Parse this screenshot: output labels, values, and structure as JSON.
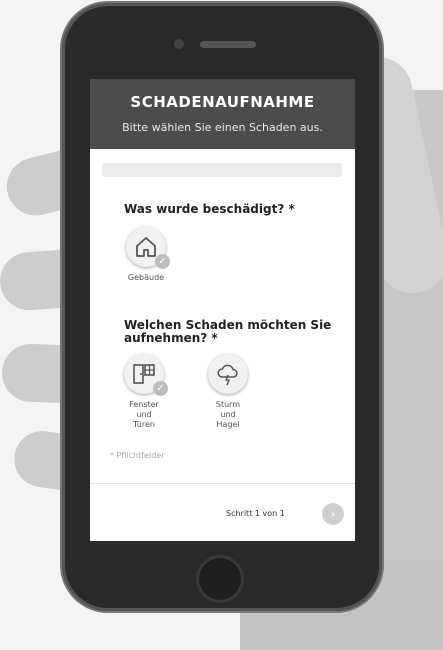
{
  "header": {
    "title": "SCHADENAUFNAHME",
    "subtitle": "Bitte wählen Sie einen Schaden aus."
  },
  "questions": [
    {
      "title": "Was wurde beschädigt? *",
      "options": [
        {
          "label": "Gebäude",
          "icon": "house-icon",
          "selected": true
        }
      ]
    },
    {
      "title": "Welchen Schaden  möchten Sie aufnehmen? *",
      "options": [
        {
          "label": "Fenster\nund\nTüren",
          "icon": "window-door-icon",
          "selected": true
        },
        {
          "label": "Sturm\nund\nHagel",
          "icon": "storm-hail-icon",
          "selected": false
        }
      ]
    }
  ],
  "required_note": "* Pflichtfelder",
  "footer": {
    "step_text": "Schritt 1 von 1",
    "next_icon": "chevron-right-icon"
  },
  "colors": {
    "header_bg": "#4c4c4c",
    "phone_body": "#2a2a2a"
  }
}
